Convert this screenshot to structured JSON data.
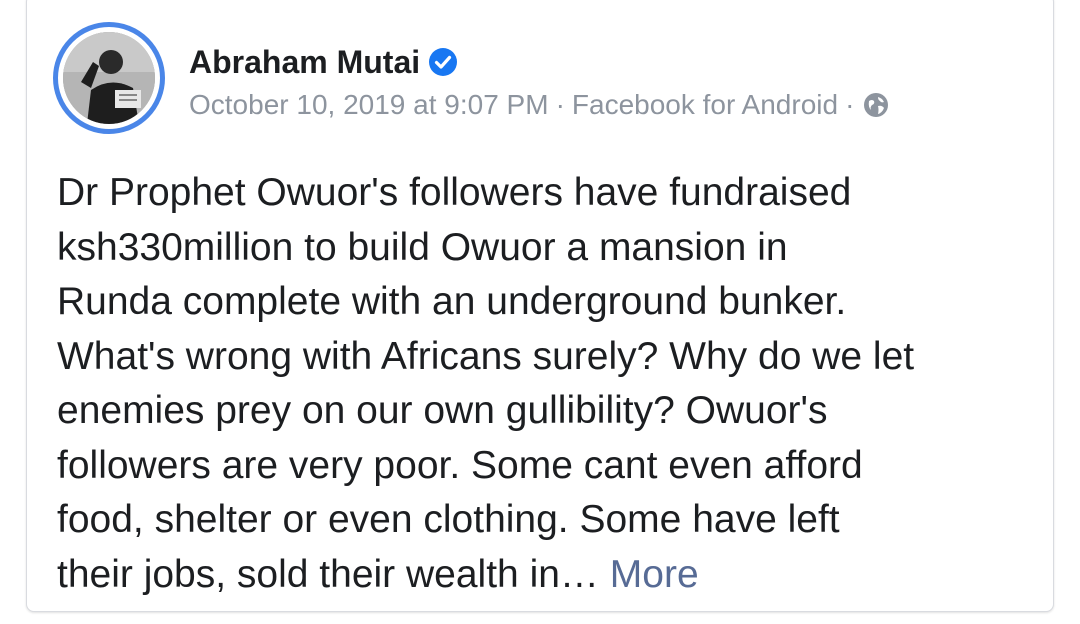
{
  "post": {
    "author": {
      "name": "Abraham Mutai",
      "verified": true
    },
    "meta": {
      "timestamp": "October 10, 2019 at 9:07 PM",
      "separator": "·",
      "source": "Facebook for Android",
      "privacy_icon": "globe-icon"
    },
    "body_lines": [
      "Dr Prophet Owuor's followers have fundraised",
      "ksh330million to build Owuor a mansion in",
      "Runda complete with an underground bunker.",
      "What's wrong with Africans surely? Why do we let",
      "enemies prey on our own gullibility? Owuor's",
      "followers are very poor. Some cant even afford",
      "food, shelter or even clothing. Some have left",
      "their jobs, sold their wealth in…"
    ],
    "more_label": "More"
  },
  "colors": {
    "verified_badge": "#1877f2",
    "avatar_ring": "#4a86e8",
    "more_link": "#576b95",
    "meta_text": "#8d949e"
  }
}
